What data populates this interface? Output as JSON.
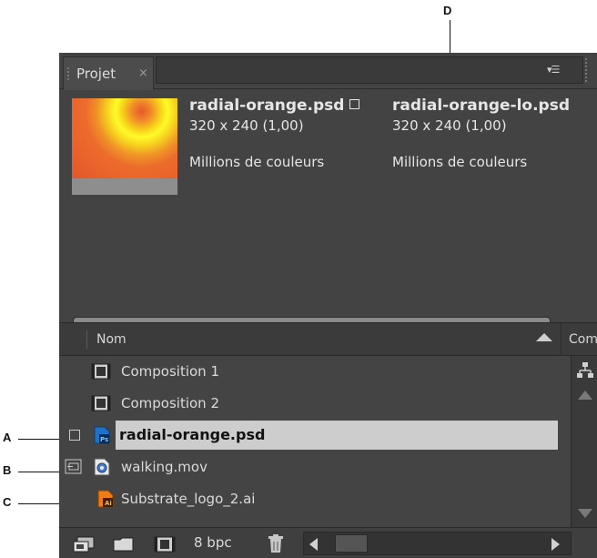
{
  "callouts": {
    "a": "A",
    "b": "B",
    "c": "C",
    "d": "D"
  },
  "panel": {
    "tab_title": "Projet",
    "tab_close": "×"
  },
  "preview": {
    "items": [
      {
        "name": "radial-orange.psd",
        "dims": "320 x 240 (1,00)",
        "colors": "Millions de couleurs"
      },
      {
        "name": "radial-orange-lo.psd",
        "dims": "320 x 240 (1,00)",
        "colors": "Millions de couleurs"
      }
    ]
  },
  "search": {
    "value": "",
    "icon": "search-icon"
  },
  "columns": {
    "name": "Nom",
    "comment": "Com"
  },
  "rows": [
    {
      "label": "Composition 1",
      "icon": "composition-icon"
    },
    {
      "label": "Composition 2",
      "icon": "composition-icon"
    },
    {
      "label": "radial-orange.psd",
      "icon": "photoshop-file-icon",
      "selected": true
    },
    {
      "label": "walking.mov",
      "icon": "quicktime-file-icon"
    },
    {
      "label": "Substrate_logo_2.ai",
      "icon": "illustrator-file-icon"
    }
  ],
  "footer": {
    "bpc": "8 bpc"
  },
  "colors": {
    "panel_bg": "#434343",
    "selected_row": "#cdcdcd",
    "photoshop": "#1e73c8",
    "illustrator": "#f07d14"
  }
}
